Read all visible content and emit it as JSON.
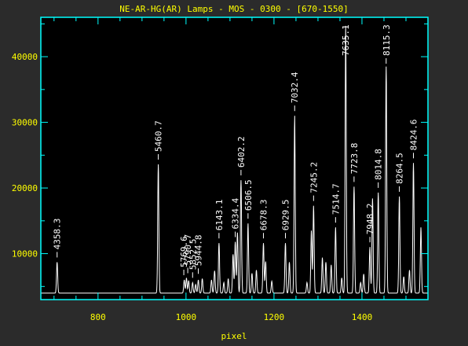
{
  "chart_data": {
    "type": "line",
    "title": "NE-AR-HG(AR) Lamps - MOS - 0300 - [670-1550]",
    "xlabel": "pixel",
    "ylabel": "",
    "xlim": [
      670,
      1550
    ],
    "ylim": [
      3000,
      46000
    ],
    "xticks": [
      800,
      1000,
      1200,
      1400
    ],
    "yticks": [
      10000,
      20000,
      30000,
      40000
    ],
    "baseline": 4000,
    "colors": {
      "axes": "#00ffff",
      "text": "#ffff00",
      "trace": "#ffffff",
      "background": "#000000"
    },
    "peaks": [
      {
        "x": 707,
        "y": 8700
      },
      {
        "x": 937,
        "y": 23600
      },
      {
        "x": 996,
        "y": 6000
      },
      {
        "x": 1001,
        "y": 6300
      },
      {
        "x": 1006,
        "y": 5900
      },
      {
        "x": 1015,
        "y": 5600
      },
      {
        "x": 1022,
        "y": 5300
      },
      {
        "x": 1028,
        "y": 6000
      },
      {
        "x": 1037,
        "y": 6200
      },
      {
        "x": 1058,
        "y": 6000
      },
      {
        "x": 1065,
        "y": 7400
      },
      {
        "x": 1075,
        "y": 11600
      },
      {
        "x": 1086,
        "y": 5600
      },
      {
        "x": 1096,
        "y": 6200
      },
      {
        "x": 1107,
        "y": 9900
      },
      {
        "x": 1112,
        "y": 11800
      },
      {
        "x": 1117,
        "y": 13200
      },
      {
        "x": 1125,
        "y": 21200
      },
      {
        "x": 1141,
        "y": 14600
      },
      {
        "x": 1150,
        "y": 7000
      },
      {
        "x": 1160,
        "y": 7500
      },
      {
        "x": 1176,
        "y": 11600
      },
      {
        "x": 1181,
        "y": 8800
      },
      {
        "x": 1195,
        "y": 5800
      },
      {
        "x": 1226,
        "y": 11600
      },
      {
        "x": 1235,
        "y": 8700
      },
      {
        "x": 1247,
        "y": 31000
      },
      {
        "x": 1275,
        "y": 5600
      },
      {
        "x": 1285,
        "y": 13500
      },
      {
        "x": 1290,
        "y": 17300
      },
      {
        "x": 1310,
        "y": 9400
      },
      {
        "x": 1318,
        "y": 8700
      },
      {
        "x": 1330,
        "y": 8300
      },
      {
        "x": 1340,
        "y": 14000
      },
      {
        "x": 1354,
        "y": 6300
      },
      {
        "x": 1363,
        "y": 44700
      },
      {
        "x": 1382,
        "y": 20200
      },
      {
        "x": 1397,
        "y": 5600
      },
      {
        "x": 1404,
        "y": 6900
      },
      {
        "x": 1418,
        "y": 11000
      },
      {
        "x": 1424,
        "y": 18400
      },
      {
        "x": 1437,
        "y": 19300
      },
      {
        "x": 1455,
        "y": 38500
      },
      {
        "x": 1485,
        "y": 18700
      },
      {
        "x": 1495,
        "y": 6500
      },
      {
        "x": 1508,
        "y": 7500
      },
      {
        "x": 1517,
        "y": 23800
      },
      {
        "x": 1534,
        "y": 14000
      }
    ],
    "annotations": [
      {
        "label": "4358.3",
        "x": 707,
        "peak": 8700
      },
      {
        "label": "5460.7",
        "x": 937,
        "peak": 23600
      },
      {
        "label": "5769.6",
        "x": 995,
        "peak": 6000
      },
      {
        "label": "5790.7",
        "x": 1004,
        "peak": 6300
      },
      {
        "label": "5852.5",
        "x": 1015,
        "peak": 5600
      },
      {
        "label": "5944.8",
        "x": 1028,
        "peak": 6200
      },
      {
        "label": "6143.1",
        "x": 1075,
        "peak": 11600
      },
      {
        "label": "6334.4",
        "x": 1112,
        "peak": 11800
      },
      {
        "label": "6402.2",
        "x": 1125,
        "peak": 21200
      },
      {
        "label": "6506.5",
        "x": 1141,
        "peak": 14600
      },
      {
        "label": "6678.3",
        "x": 1176,
        "peak": 11600
      },
      {
        "label": "6929.5",
        "x": 1226,
        "peak": 11600
      },
      {
        "label": "7032.4",
        "x": 1247,
        "peak": 31000
      },
      {
        "label": "7245.2",
        "x": 1290,
        "peak": 17300
      },
      {
        "label": "7514.7",
        "x": 1340,
        "peak": 14000
      },
      {
        "label": "7635.1",
        "x": 1363,
        "peak": 44700
      },
      {
        "label": "7723.8",
        "x": 1382,
        "peak": 20200
      },
      {
        "label": "7948.2",
        "x": 1418,
        "peak": 11000
      },
      {
        "label": "8014.8",
        "x": 1437,
        "peak": 19300
      },
      {
        "label": "8115.3",
        "x": 1455,
        "peak": 38500
      },
      {
        "label": "8264.5",
        "x": 1485,
        "peak": 18700
      },
      {
        "label": "8424.6",
        "x": 1517,
        "peak": 23800
      }
    ]
  }
}
